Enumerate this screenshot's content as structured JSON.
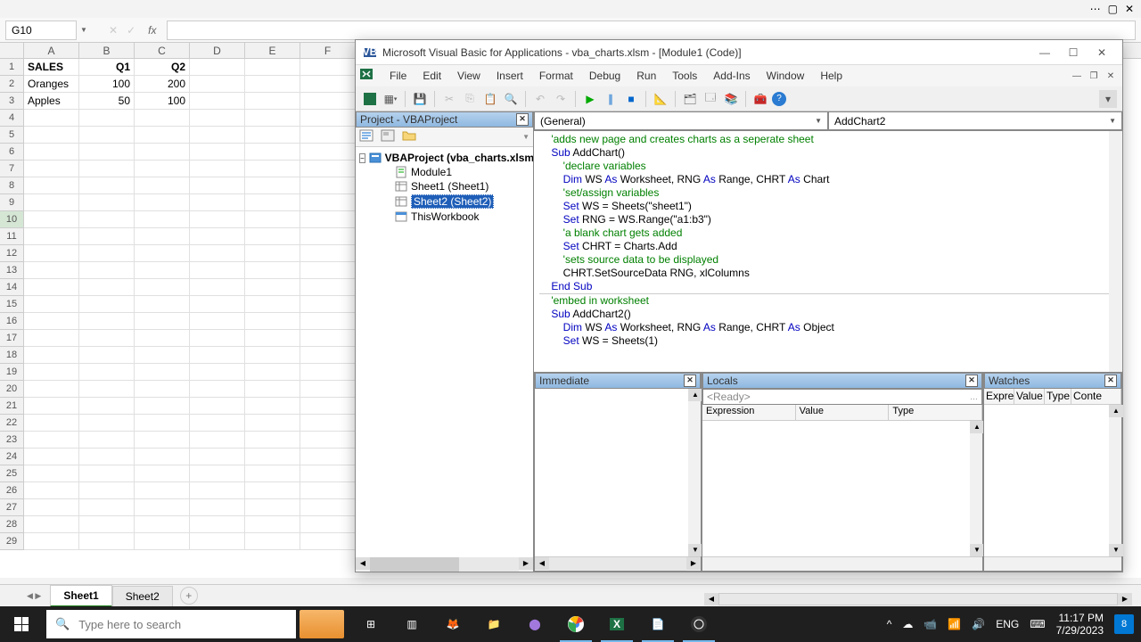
{
  "excel": {
    "namebox": "G10",
    "fx": "fx",
    "columns": [
      "A",
      "B",
      "C",
      "D",
      "E",
      "F"
    ],
    "data": [
      [
        "SALES",
        "Q1",
        "Q2",
        "",
        "",
        ""
      ],
      [
        "Oranges",
        "100",
        "200",
        "",
        "",
        ""
      ],
      [
        "Apples",
        "50",
        "100",
        "",
        "",
        ""
      ]
    ],
    "sheets": {
      "active": "Sheet1",
      "other": "Sheet2"
    }
  },
  "vba": {
    "title": "Microsoft Visual Basic for Applications - vba_charts.xlsm - [Module1 (Code)]",
    "menu": [
      "File",
      "Edit",
      "View",
      "Insert",
      "Format",
      "Debug",
      "Run",
      "Tools",
      "Add-Ins",
      "Window",
      "Help"
    ],
    "project_panel_title": "Project - VBAProject",
    "tree": {
      "root": "VBAProject (vba_charts.xlsm",
      "module": "Module1",
      "sheet1": "Sheet1 (Sheet1)",
      "sheet2": "Sheet2 (Sheet2)",
      "workbook": "ThisWorkbook"
    },
    "dropdown_left": "(General)",
    "dropdown_right": "AddChart2",
    "code": {
      "c1": "    'adds new page and creates charts as a seperate sheet",
      "l2a": "    Sub",
      "l2b": " AddChart()",
      "c3": "        'declare variables",
      "l4a": "        Dim",
      "l4b": " WS ",
      "l4c": "As",
      "l4d": " Worksheet, RNG ",
      "l4e": "As",
      "l4f": " Range, CHRT ",
      "l4g": "As",
      "l4h": " Chart",
      "c5": "        'set/assign variables",
      "l6a": "        Set",
      "l6b": " WS = Sheets(\"sheet1\")",
      "l7a": "        Set",
      "l7b": " RNG = WS.Range(\"a1:b3\")",
      "c8": "        'a blank chart gets added",
      "l9a": "        Set",
      "l9b": " CHRT = Charts.Add",
      "c10": "        'sets source data to be displayed",
      "l11": "        CHRT.SetSourceData RNG, xlColumns",
      "l12": "    End Sub",
      "c13": "    'embed in worksheet",
      "l14a": "    Sub",
      "l14b": " AddChart2()",
      "l15a": "        Dim",
      "l15b": " WS ",
      "l15c": "As",
      "l15d": " Worksheet, RNG ",
      "l15e": "As",
      "l15f": " Range, CHRT ",
      "l15g": "As",
      "l15h": " Object",
      "l16a": "        Set",
      "l16b": " WS = Sheets(1)"
    },
    "immediate_title": "Immediate",
    "locals_title": "Locals",
    "locals_ready": "<Ready>",
    "locals_cols": {
      "expr": "Expression",
      "val": "Value",
      "type": "Type"
    },
    "watches_title": "Watches",
    "watches_cols": {
      "expr": "Expre",
      "val": "Value",
      "type": "Type",
      "ctx": "Conte"
    }
  },
  "taskbar": {
    "search_placeholder": "Type here to search",
    "time": "11:17 PM",
    "date": "7/29/2023",
    "notif_count": "8"
  }
}
